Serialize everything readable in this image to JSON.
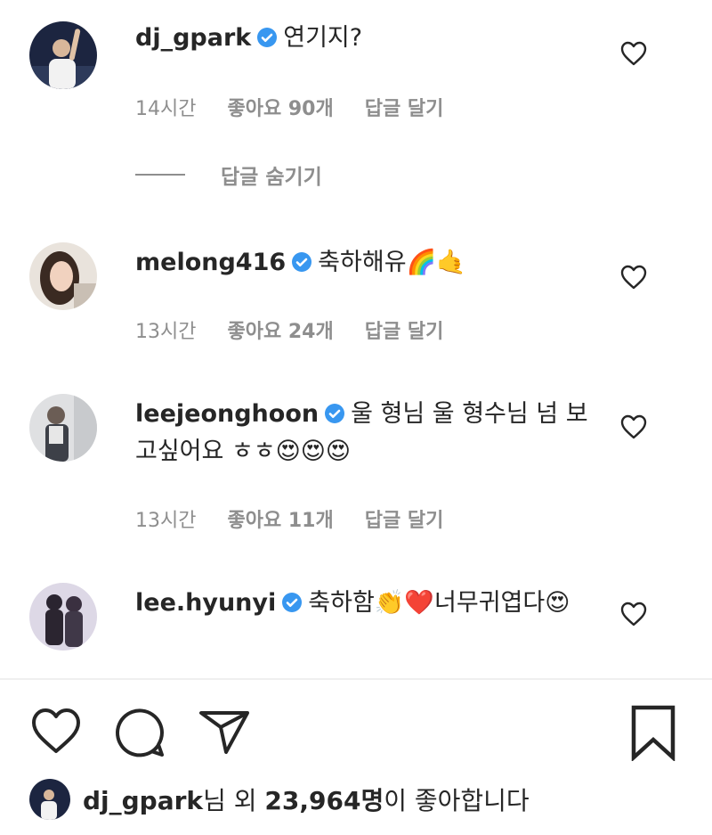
{
  "comments": [
    {
      "username": "dj_gpark",
      "text": "연기지?",
      "time": "14시간",
      "likes": "좋아요 90개",
      "reply": "답글 달기"
    },
    {
      "username": "melong416",
      "text": "축하해유🌈🤙",
      "time": "13시간",
      "likes": "좋아요 24개",
      "reply": "답글 달기"
    },
    {
      "username": "leejeonghoon",
      "text": "울 형님 울 형수님 넘 보고싶어요 ㅎㅎ😍😍😍",
      "time": "13시간",
      "likes": "좋아요 11개",
      "reply": "답글 달기"
    },
    {
      "username": "lee.hyunyi",
      "text": "축하함👏❤️너무귀엽다😍"
    }
  ],
  "hide_replies": "답글 숨기기",
  "likes_summary": {
    "username": "dj_gpark",
    "suffix_1": "님 외 ",
    "count": "23,964명",
    "suffix_2": "이 좋아합니다"
  },
  "icons": {
    "verified": "verified-badge-icon",
    "heart": "heart-icon",
    "comment": "comment-icon",
    "share": "share-icon",
    "bookmark": "bookmark-icon"
  },
  "colors": {
    "verified": "#3897f0",
    "text": "#262626",
    "muted": "#8e8e8e"
  }
}
